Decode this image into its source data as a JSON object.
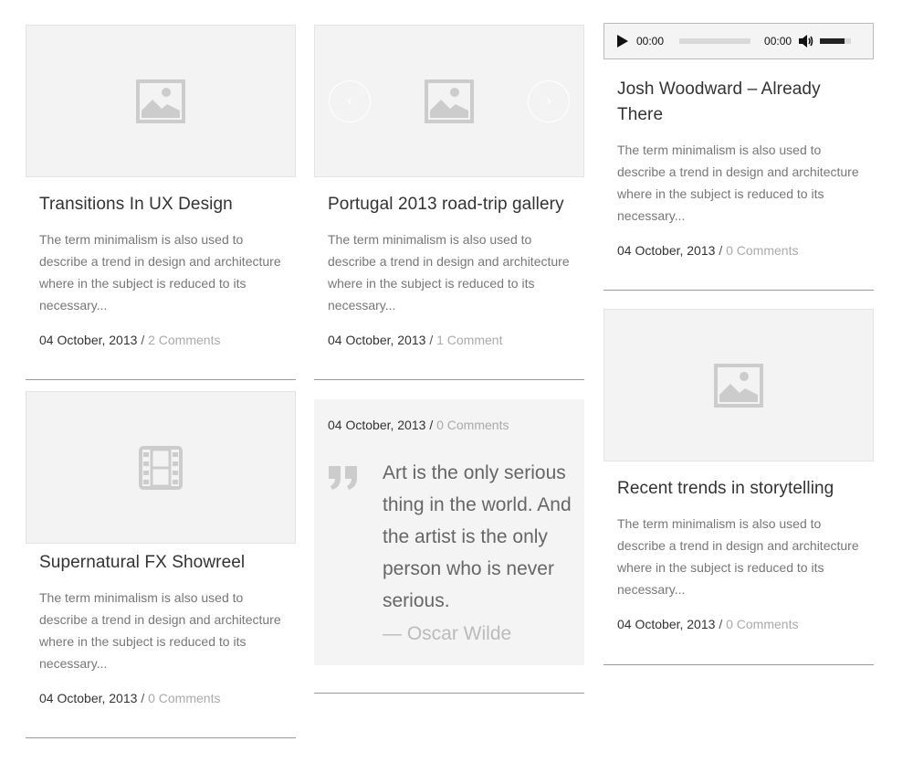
{
  "posts": {
    "p1": {
      "title": "Transitions In UX Design",
      "excerpt": "The term minimalism is also used to describe a trend in design and architecture where in the subject is reduced to its necessary...",
      "date": "04 October, 2013",
      "comments": "2 Comments",
      "media_icon": "image-placeholder-icon"
    },
    "p2": {
      "title": "Portugal 2013 road-trip gallery",
      "excerpt": "The term minimalism is also used to describe a trend in design and architecture where in the subject is reduced to its necessary...",
      "date": "04 October, 2013",
      "comments": "1 Comment",
      "media_icon": "image-placeholder-icon"
    },
    "p3": {
      "title": "Josh Woodward – Already There",
      "excerpt": "The term minimalism is also used to describe a trend in design and architecture where in the subject is reduced to its necessary...",
      "date": "04 October, 2013",
      "comments": "0 Comments",
      "audio": {
        "current_time": "00:00",
        "duration": "00:00",
        "volume": 0.8
      }
    },
    "p4": {
      "title": "Supernatural FX Showreel",
      "excerpt": "The term minimalism is also used to describe a trend in design and architecture where in the subject is reduced to its necessary...",
      "date": "04 October, 2013",
      "comments": "0 Comments",
      "media_icon": "film-placeholder-icon"
    },
    "p5": {
      "date": "04 October, 2013",
      "comments": "0 Comments",
      "quote": "Art is the only serious thing in the world. And the artist is the only person who is never serious.",
      "author": "— Oscar Wilde"
    },
    "p6": {
      "title": "Recent trends in storytelling",
      "excerpt": "The term minimalism is also used to describe a trend in design and architecture where in the subject is reduced to its necessary...",
      "date": "04 October, 2013",
      "comments": "0 Comments",
      "media_icon": "image-placeholder-icon"
    }
  },
  "separator": "/",
  "colors": {
    "placeholder_bg": "#f3f3f3",
    "icon": "#cccccc",
    "muted_link": "#aaaaaa",
    "divider": "#9a9a9a"
  }
}
